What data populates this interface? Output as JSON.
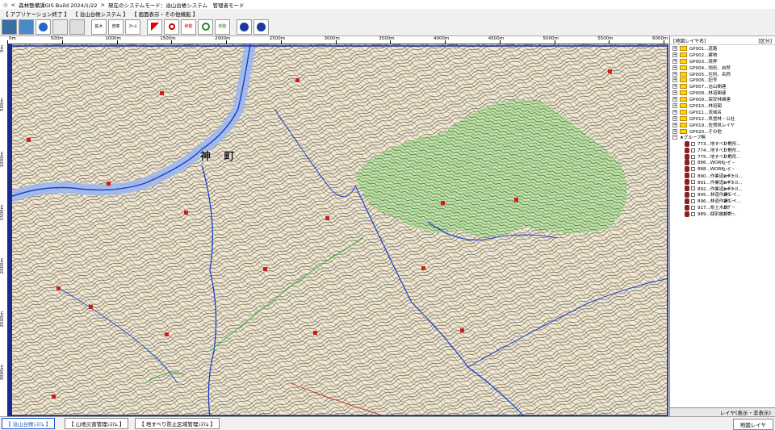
{
  "window": {
    "app_title": "森林整備課GIS Build 2024/1/22",
    "mode_label": "現在のシステムモード：治山台帳システム　管理者モード"
  },
  "menu": {
    "items": [
      "【 アプリケーション終了 】",
      "【 治山台帳システム 】",
      "【 画面表示・その他機能 】"
    ]
  },
  "toolbar": {
    "buttons": [
      "",
      "",
      "",
      "",
      "",
      "",
      "拡大",
      "倍率",
      "ｽｹｰﾙ",
      "",
      "",
      "移動",
      "",
      "移動",
      "",
      ""
    ]
  },
  "ruler": {
    "top_labels": [
      "0m",
      "500m",
      "1000m",
      "1500m",
      "2000m",
      "2500m",
      "3000m",
      "3500m",
      "4000m",
      "4500m",
      "5000m",
      "5500m",
      "6000m"
    ],
    "left_labels": [
      "0m",
      "500m",
      "1000m",
      "1500m",
      "2000m",
      "2500m",
      "3000m"
    ]
  },
  "map": {
    "place_name": "神 町"
  },
  "layer_panel": {
    "header_left": "[地図レイヤ名]",
    "header_right": "[区分]",
    "groups": [
      "GP001...道路",
      "GP002...建物",
      "GP003...境界",
      "GP004...地形、自然",
      "GP005...住所、名称",
      "GP006...記号",
      "GP007...治山関連",
      "GP008...林道関連",
      "GP009...保安林関連",
      "GP010...林班図",
      "GP011...流域名",
      "GP012...県営林・公社",
      "GP019...佐賀県レイヤ",
      "GP020...その他"
    ],
    "group_header": "★グループ無",
    "layers": [
      {
        "name": "773...地すべり地形...",
        "type": "ﾕｰｻﾞｰ"
      },
      {
        "name": "774...地すべり地形...",
        "type": "ﾕｰｻﾞｰ"
      },
      {
        "name": "775...地すべり地形...",
        "type": "ﾕｰｻﾞｰ"
      },
      {
        "name": "886...WORK",
        "type": "ﾕｰｻﾞｰ"
      },
      {
        "name": "888...WORK",
        "type": "ﾕｰｻﾞｰ"
      },
      {
        "name": "890...作業道w=3.0...",
        "type": "ﾕｰｻﾞｰ"
      },
      {
        "name": "891...作業道w=3.0...",
        "type": "ﾕｰｻﾞｰ"
      },
      {
        "name": "892...作業道w=3.0...",
        "type": "ﾕｰｻﾞｰ"
      },
      {
        "name": "895...林道作業レイ...",
        "type": "ﾕｰｻﾞｰ"
      },
      {
        "name": "896...林道作業レイ...",
        "type": "ﾕｰｻﾞｰ"
      },
      {
        "name": "917...県土木株",
        "type": "ﾕｰｻﾞｰ"
      },
      {
        "name": "989...個別施設計...",
        "type": "ﾕｰｻﾞｰ"
      }
    ],
    "footer": "レイヤ(表示・非表示)"
  },
  "status_tabs": [
    "【 治山台帳ｼｽﾃﾑ 】",
    "【 山地災害管理ｼｽﾃﾑ 】",
    "【 地すべり防止区域管理ｼｽﾃﾑ 】"
  ],
  "right_tab": "地図レイヤ",
  "colors": {
    "frame": "#1a2b8a",
    "active_tab": "#1a55c8",
    "folder": "#ffd700",
    "layer_icon": "#8b2020"
  }
}
